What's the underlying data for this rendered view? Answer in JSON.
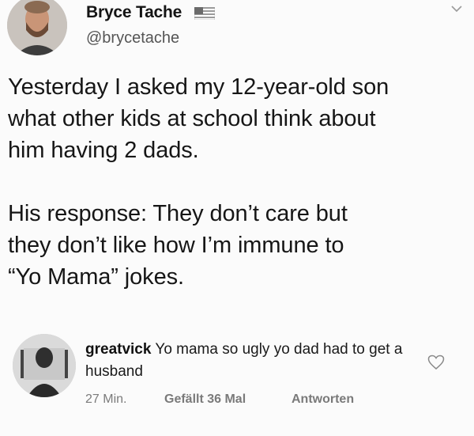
{
  "tweet": {
    "display_name": "Bryce Tache",
    "handle": "@brycetache",
    "flag_icon": "us-flag-icon",
    "text": "Yesterday I asked my 12-year-old son\nwhat other kids at school think about\nhim having 2 dads.\n\nHis response: They don’t care but\nthey don’t like how I’m immune to\n“Yo Mama” jokes."
  },
  "comment": {
    "username": "greatvick",
    "text": " Yo mama so ugly yo dad had to get a husband",
    "time": "27 Min.",
    "likes": "Gefällt 36 Mal",
    "reply": "Antworten"
  },
  "colors": {
    "background": "#fbfbfb",
    "text": "#161616",
    "muted": "#7b7b7b"
  }
}
